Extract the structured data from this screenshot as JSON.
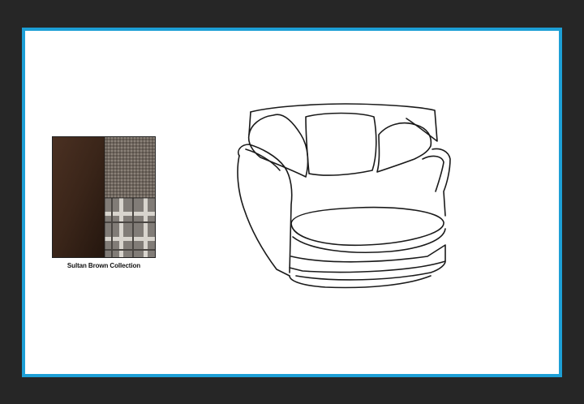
{
  "swatch": {
    "caption": "Sultan Brown Collection",
    "colors": {
      "brown": "#3a2519",
      "tweed": "#6f665e",
      "check_base": "#8a8680",
      "check_line": "#d8d4cd"
    }
  },
  "frame": {
    "border_color": "#1d9fd6",
    "background": "#ffffff"
  },
  "product": {
    "icon": "swivel-cuddler-chair-outline"
  }
}
